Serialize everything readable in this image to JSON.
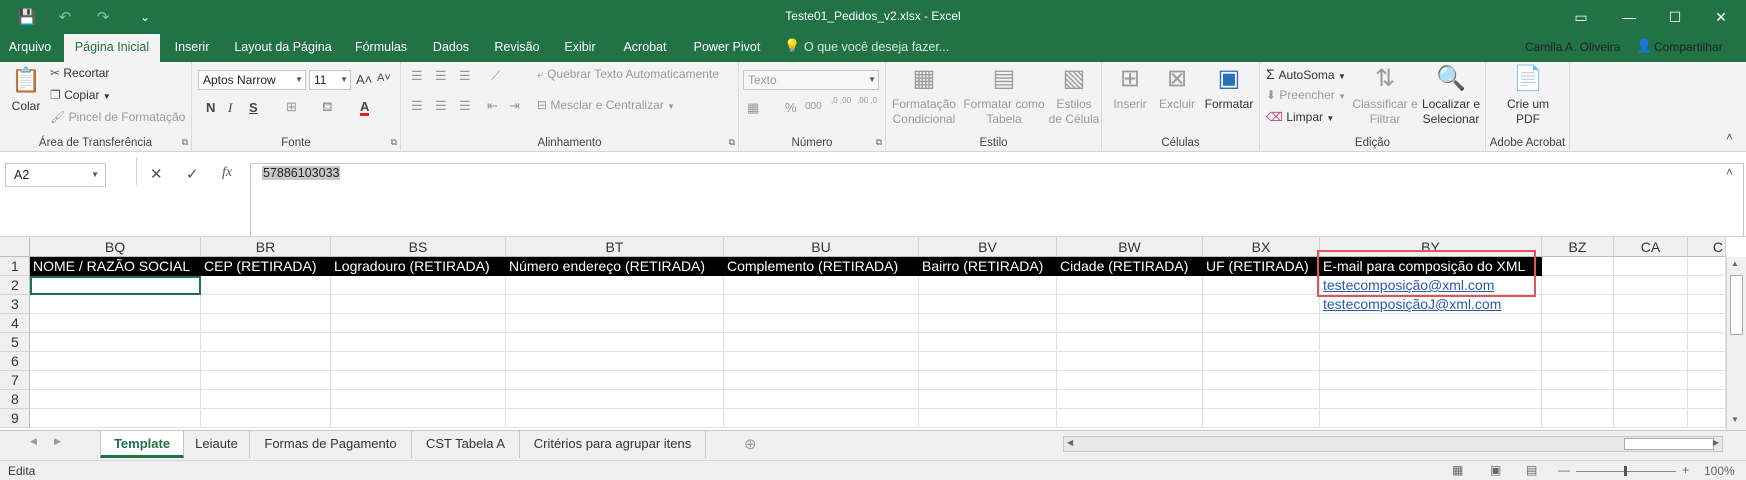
{
  "titlebar": {
    "title": "Teste01_Pedidos_v2.xlsx - Excel",
    "save_icon": "💾",
    "undo_icon": "↶",
    "redo_icon": "↷",
    "customize_icon": "⌄",
    "ribbon_opts_icon": "▭",
    "min_icon": "—",
    "max_icon": "☐",
    "close_icon": "✕"
  },
  "tabs": [
    {
      "label": "Arquivo"
    },
    {
      "label": "Página Inicial"
    },
    {
      "label": "Inserir"
    },
    {
      "label": "Layout da Página"
    },
    {
      "label": "Fórmulas"
    },
    {
      "label": "Dados"
    },
    {
      "label": "Revisão"
    },
    {
      "label": "Exibir"
    },
    {
      "label": "Acrobat"
    },
    {
      "label": "Power Pivot"
    }
  ],
  "tellme": "O que você deseja fazer...",
  "tellme_icon": "💡",
  "user": "Camila A. Oliveira",
  "share": "Compartilhar",
  "share_icon": "👤",
  "ribbon": {
    "clipboard": {
      "paste": "Colar",
      "cut": "Recortar",
      "copy": "Copiar",
      "format_painter": "Pincel de Formatação",
      "label": "Área de Transferência"
    },
    "font": {
      "name": "Aptos Narrow",
      "size": "11",
      "bold": "N",
      "italic": "I",
      "underline": "S",
      "label": "Fonte",
      "grow": "A˄",
      "shrink": "A˅",
      "fontcolor": "A"
    },
    "alignment": {
      "wrap": "Quebrar Texto Automaticamente",
      "merge": "Mesclar e Centralizar",
      "label": "Alinhamento"
    },
    "number": {
      "format": "Texto",
      "percent": "%",
      "thousands": "000",
      "inc_dec": ",0 ,00",
      "dec_dec": ",00 ,0",
      "label": "Número"
    },
    "styles": {
      "conditional": "Formatação Condicional",
      "table": "Formatar como Tabela",
      "cell": "Estilos de Célula",
      "label": "Estilo"
    },
    "cells": {
      "insert": "Inserir",
      "delete": "Excluir",
      "format": "Formatar",
      "label": "Células"
    },
    "editing": {
      "autosum": "AutoSoma",
      "fill": "Preencher",
      "clear": "Limpar",
      "sort": "Classificar e Filtrar",
      "find": "Localizar e Selecionar",
      "label": "Edição"
    },
    "acrobat": {
      "create_pdf": "Crie um PDF",
      "label": "Adobe Acrobat"
    }
  },
  "formula": {
    "namebox": "A2",
    "value": "57886103033",
    "cancel_icon": "✕",
    "enter_icon": "✓",
    "fx_icon": "fx",
    "collapse_icon": "˄"
  },
  "columns": [
    "BQ",
    "BR",
    "BS",
    "BT",
    "BU",
    "BV",
    "BW",
    "BX",
    "BY",
    "BZ",
    "CA",
    "C"
  ],
  "rows": [
    "1",
    "2",
    "3",
    "4",
    "5",
    "6",
    "7",
    "8",
    "9"
  ],
  "header_row": [
    "NOME / RAZÃO SOCIAL",
    "CEP  (RETIRADA)",
    "Logradouro  (RETIRADA)",
    "Número endereço  (RETIRADA)",
    "Complemento  (RETIRADA)",
    "Bairro  (RETIRADA)",
    "Cidade  (RETIRADA)",
    "UF  (RETIRADA)",
    "E-mail para composição do XML"
  ],
  "emails": [
    "testecomposição@xml.com",
    "testecomposiçãoJ@xml.com"
  ],
  "sheets": [
    "Template",
    "Leiaute",
    "Formas de Pagamento",
    "CST Tabela A",
    "Critérios para agrupar itens"
  ],
  "add_sheet_icon": "⊕",
  "status": {
    "mode": "Edita",
    "zoom": "100%",
    "zoom_minus": "—",
    "zoom_plus": "+"
  }
}
